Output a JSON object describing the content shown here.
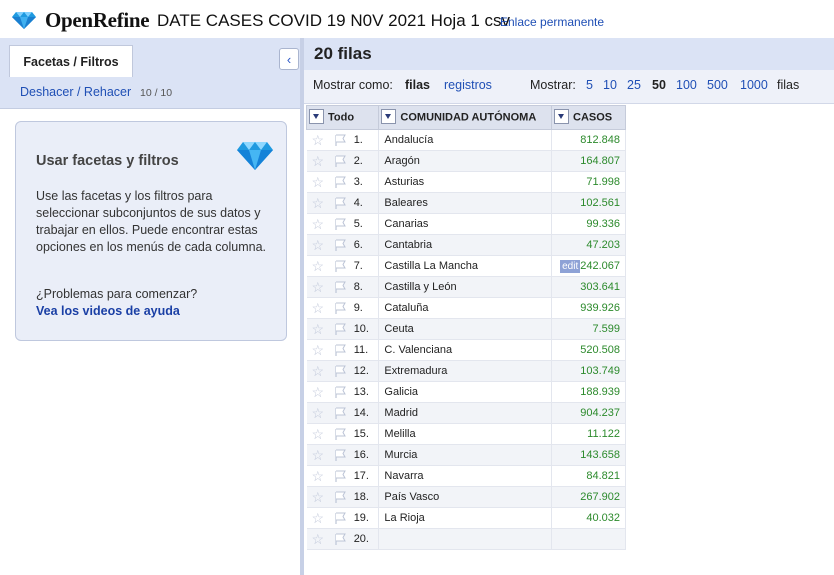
{
  "app": {
    "name": "OpenRefine",
    "project_title": "DATE CASES COVID 19 N0V 2021 Hoja 1 csv",
    "permalink": "Enlace permanente"
  },
  "left": {
    "tab_label": "Facetas / Filtros",
    "collapse_icon": "chevron-left-icon",
    "undo_label": "Deshacer / Rehacer",
    "undo_count": "10 / 10",
    "help": {
      "title": "Usar facetas y filtros",
      "description": "Use las facetas y los filtros para seleccionar subconjuntos de sus datos y trabajar en ellos. Puede encontrar estas opciones en los menús de cada columna.",
      "problem": "¿Problemas para comenzar?",
      "video_link": "Vea los videos de ayuda"
    }
  },
  "right": {
    "row_count": "20 filas",
    "show_as_label": "Mostrar como:",
    "mode_rows": "filas",
    "mode_records": "registros",
    "show_label": "Mostrar:",
    "page_sizes": [
      "5",
      "10",
      "25",
      "50",
      "100",
      "500",
      "1000"
    ],
    "page_size_selected": "50",
    "rows_suffix": "filas",
    "columns": [
      "Todo",
      "COMUNIDAD AUTÓNOMA",
      "CASOS"
    ],
    "edit_label": "edit",
    "rows": [
      {
        "idx": "1.",
        "comunidad": "Andalucía",
        "casos": "812.848"
      },
      {
        "idx": "2.",
        "comunidad": "Aragón",
        "casos": "164.807"
      },
      {
        "idx": "3.",
        "comunidad": "Asturias",
        "casos": "71.998"
      },
      {
        "idx": "4.",
        "comunidad": "Baleares",
        "casos": "102.561"
      },
      {
        "idx": "5.",
        "comunidad": "Canarias",
        "casos": "99.336"
      },
      {
        "idx": "6.",
        "comunidad": "Cantabria",
        "casos": "47.203"
      },
      {
        "idx": "7.",
        "comunidad": "Castilla La Mancha",
        "casos": "242.067"
      },
      {
        "idx": "8.",
        "comunidad": "Castilla y León",
        "casos": "303.641"
      },
      {
        "idx": "9.",
        "comunidad": "Cataluña",
        "casos": "939.926"
      },
      {
        "idx": "10.",
        "comunidad": "Ceuta",
        "casos": "7.599"
      },
      {
        "idx": "11.",
        "comunidad": "C. Valenciana",
        "casos": "520.508"
      },
      {
        "idx": "12.",
        "comunidad": "Extremadura",
        "casos": "103.749"
      },
      {
        "idx": "13.",
        "comunidad": "Galicia",
        "casos": "188.939"
      },
      {
        "idx": "14.",
        "comunidad": "Madrid",
        "casos": "904.237"
      },
      {
        "idx": "15.",
        "comunidad": "Melilla",
        "casos": "11.122"
      },
      {
        "idx": "16.",
        "comunidad": "Murcia",
        "casos": "143.658"
      },
      {
        "idx": "17.",
        "comunidad": "Navarra",
        "casos": "84.821"
      },
      {
        "idx": "18.",
        "comunidad": "País Vasco",
        "casos": "267.902"
      },
      {
        "idx": "19.",
        "comunidad": "La Rioja",
        "casos": "40.032"
      },
      {
        "idx": "20.",
        "comunidad": "",
        "casos": ""
      }
    ]
  },
  "colors": {
    "accent": "#1f4fb5",
    "panel": "#dbe3f5",
    "number": "#2c8a2c"
  }
}
